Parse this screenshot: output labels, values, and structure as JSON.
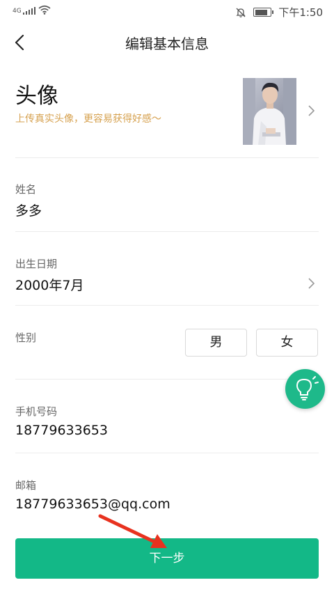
{
  "status_bar": {
    "network": "4G",
    "time": "下午1:50",
    "battery_level_percent": 85
  },
  "header": {
    "title": "编辑基本信息",
    "back_icon": "chevron-left-icon"
  },
  "avatar": {
    "title": "头像",
    "hint": "上传真实头像，更容易获得好感～"
  },
  "fields": {
    "name": {
      "label": "姓名",
      "value": "多多"
    },
    "birthday": {
      "label": "出生日期",
      "value": "2000年7月"
    },
    "gender": {
      "label": "性别",
      "options": [
        "男",
        "女"
      ]
    },
    "phone": {
      "label": "手机号码",
      "value": "18779633653"
    },
    "email": {
      "label": "邮箱",
      "value": "18779633653@qq.com"
    }
  },
  "floating_button": {
    "icon": "lightbulb-icon"
  },
  "next_button": {
    "label": "下一步"
  },
  "colors": {
    "accent": "#13b887",
    "hint": "#d6a14f",
    "annotation_arrow": "#e8321f"
  }
}
